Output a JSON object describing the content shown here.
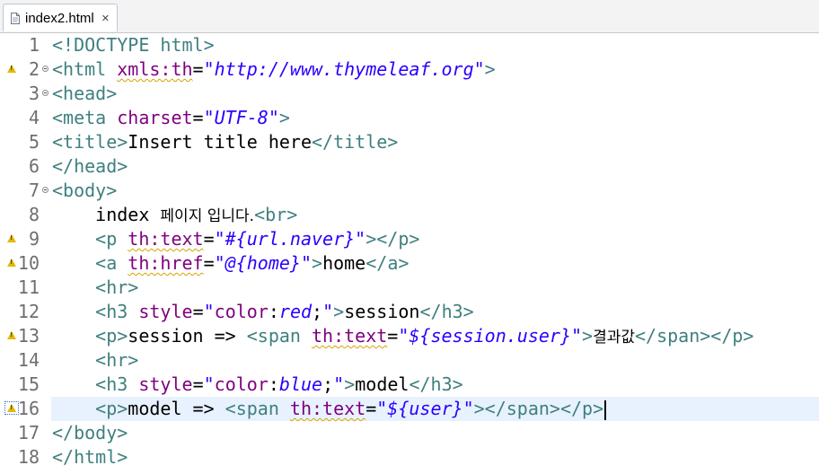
{
  "tab": {
    "title": "index2.html",
    "close_glyph": "✕",
    "icon": "html-file-icon"
  },
  "lines": [
    {
      "n": "1",
      "parts": [
        [
          "teal",
          "<!DOCTYPE html>"
        ]
      ]
    },
    {
      "n": "2",
      "marker": "warning",
      "fold": true,
      "parts": [
        [
          "teal",
          "<html "
        ],
        [
          "attr squig",
          "xmls:th"
        ],
        [
          "blk",
          "="
        ],
        [
          "str",
          "\"http://www.thymeleaf.org\""
        ],
        [
          "teal",
          ">"
        ]
      ]
    },
    {
      "n": "3",
      "fold": true,
      "parts": [
        [
          "teal",
          "<head>"
        ]
      ]
    },
    {
      "n": "4",
      "parts": [
        [
          "teal",
          "<meta "
        ],
        [
          "attr",
          "charset"
        ],
        [
          "blk",
          "="
        ],
        [
          "str",
          "\"UTF-8\""
        ],
        [
          "teal",
          ">"
        ]
      ]
    },
    {
      "n": "5",
      "parts": [
        [
          "teal",
          "<title>"
        ],
        [
          "blk",
          "Insert title here"
        ],
        [
          "teal",
          "</title>"
        ]
      ]
    },
    {
      "n": "6",
      "parts": [
        [
          "teal",
          "</head>"
        ]
      ]
    },
    {
      "n": "7",
      "fold": true,
      "parts": [
        [
          "teal",
          "<body>"
        ]
      ]
    },
    {
      "n": "8",
      "parts": [
        [
          "blk",
          "    index "
        ],
        [
          "blk kr",
          "페이지 입니다."
        ],
        [
          "teal",
          "<br>"
        ]
      ]
    },
    {
      "n": "9",
      "marker": "warning",
      "parts": [
        [
          "blk",
          "    "
        ],
        [
          "teal",
          "<p "
        ],
        [
          "attr squig",
          "th:text"
        ],
        [
          "blk",
          "="
        ],
        [
          "str",
          "\"#{url.naver}\""
        ],
        [
          "teal",
          "></p>"
        ]
      ]
    },
    {
      "n": "10",
      "marker": "warning",
      "parts": [
        [
          "blk",
          "    "
        ],
        [
          "teal",
          "<a "
        ],
        [
          "attr squig",
          "th:href"
        ],
        [
          "blk",
          "="
        ],
        [
          "str",
          "\"@{home}\""
        ],
        [
          "teal",
          ">"
        ],
        [
          "blk",
          "home"
        ],
        [
          "teal",
          "</a>"
        ]
      ]
    },
    {
      "n": "11",
      "parts": [
        [
          "blk",
          "    "
        ],
        [
          "teal",
          "<hr>"
        ]
      ]
    },
    {
      "n": "12",
      "parts": [
        [
          "blk",
          "    "
        ],
        [
          "teal",
          "<h3 "
        ],
        [
          "attr",
          "style"
        ],
        [
          "blk",
          "="
        ],
        [
          "str",
          "\""
        ],
        [
          "attr",
          "color"
        ],
        [
          "blk",
          ":"
        ],
        [
          "str",
          "red"
        ],
        [
          "blk",
          ";"
        ],
        [
          "str",
          "\""
        ],
        [
          "teal",
          ">"
        ],
        [
          "blk",
          "session"
        ],
        [
          "teal",
          "</h3>"
        ]
      ]
    },
    {
      "n": "13",
      "marker": "warning",
      "parts": [
        [
          "blk",
          "    "
        ],
        [
          "teal",
          "<p>"
        ],
        [
          "blk",
          "session => "
        ],
        [
          "teal",
          "<span "
        ],
        [
          "attr squig",
          "th:text"
        ],
        [
          "blk",
          "="
        ],
        [
          "str",
          "\"${session.user}\""
        ],
        [
          "teal",
          ">"
        ],
        [
          "blk kr",
          "결과값"
        ],
        [
          "teal",
          "</span></p>"
        ]
      ]
    },
    {
      "n": "14",
      "parts": [
        [
          "blk",
          "    "
        ],
        [
          "teal",
          "<hr>"
        ]
      ]
    },
    {
      "n": "15",
      "parts": [
        [
          "blk",
          "    "
        ],
        [
          "teal",
          "<h3 "
        ],
        [
          "attr",
          "style"
        ],
        [
          "blk",
          "="
        ],
        [
          "str",
          "\""
        ],
        [
          "attr",
          "color"
        ],
        [
          "blk",
          ":"
        ],
        [
          "str",
          "blue"
        ],
        [
          "blk",
          ";"
        ],
        [
          "str",
          "\""
        ],
        [
          "teal",
          ">"
        ],
        [
          "blk",
          "model"
        ],
        [
          "teal",
          "</h3>"
        ]
      ]
    },
    {
      "n": "16",
      "marker": "warning-selected",
      "current": true,
      "caret": true,
      "parts": [
        [
          "blk",
          "    "
        ],
        [
          "teal",
          "<p>"
        ],
        [
          "blk",
          "model => "
        ],
        [
          "teal",
          "<span "
        ],
        [
          "attr squig",
          "th:text"
        ],
        [
          "blk",
          "="
        ],
        [
          "str",
          "\"${user}\""
        ],
        [
          "teal",
          "></span></p>"
        ]
      ]
    },
    {
      "n": "17",
      "parts": [
        [
          "teal",
          "</body>"
        ]
      ]
    },
    {
      "n": "18",
      "parts": [
        [
          "teal",
          "</html>"
        ]
      ]
    }
  ]
}
